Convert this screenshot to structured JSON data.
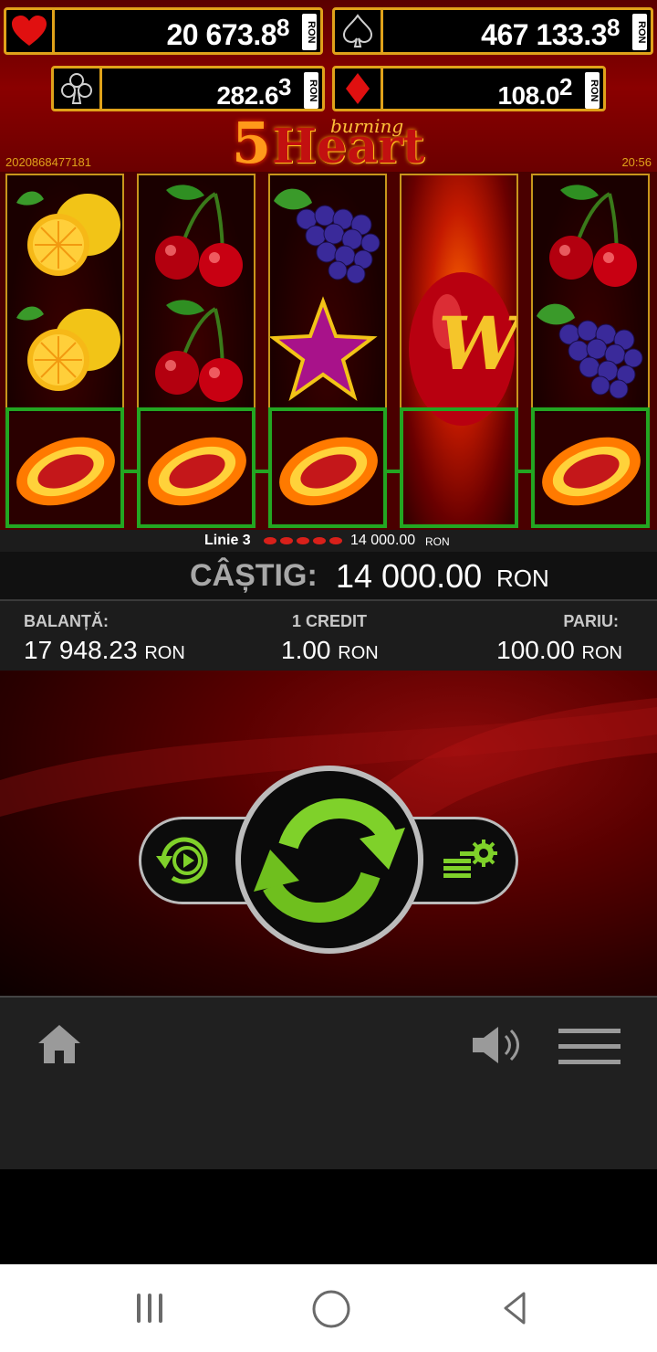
{
  "jackpots": [
    {
      "suit": "heart-icon",
      "main": "20 673.8",
      "sup": "8",
      "currency": "RON"
    },
    {
      "suit": "spade-icon",
      "main": "467 133.3",
      "sup": "8",
      "currency": "RON"
    },
    {
      "suit": "club-icon",
      "main": "282.6",
      "sup": "3",
      "currency": "RON"
    },
    {
      "suit": "diamond-icon",
      "main": "108.0",
      "sup": "2",
      "currency": "RON"
    }
  ],
  "game": {
    "title_number": "5",
    "title_word": "Heart",
    "title_script": "burning",
    "session_id": "2020868477181",
    "clock": "20:56"
  },
  "reels": [
    [
      "lemon",
      "lemon",
      "burning-watermelon"
    ],
    [
      "cherries",
      "cherries",
      "burning-watermelon"
    ],
    [
      "grapes",
      "star",
      "burning-watermelon"
    ],
    [
      "wild",
      "wild",
      "wild"
    ],
    [
      "cherries",
      "grapes",
      "burning-watermelon"
    ]
  ],
  "win_line": {
    "line_label": "Linie 3",
    "amount": "14 000.00",
    "currency": "RON"
  },
  "castig": {
    "label": "CÂȘTIG:",
    "amount": "14 000.00",
    "currency": "RON"
  },
  "info": {
    "balance_label": "BALANȚĂ:",
    "balance": "17 948.23",
    "balance_currency": "RON",
    "credit_label": "1 CREDIT",
    "credit": "1.00",
    "credit_currency": "RON",
    "bet_label": "PARIU:",
    "bet": "100.00",
    "bet_currency": "RON"
  },
  "controls": {
    "autoplay": "autoplay-icon",
    "spin": "spin-icon",
    "bet_settings": "bet-settings-icon"
  },
  "toolbar": {
    "home": "home-icon",
    "sound": "speaker-icon",
    "menu": "hamburger-menu-icon"
  },
  "colors": {
    "gold": "#e0a21a",
    "win_green": "#23a622",
    "spin_green": "#7fd12a",
    "dark_red": "#5a0000"
  },
  "android_nav": {
    "recents": "recents-icon",
    "home": "home-circle-icon",
    "back": "back-icon"
  }
}
